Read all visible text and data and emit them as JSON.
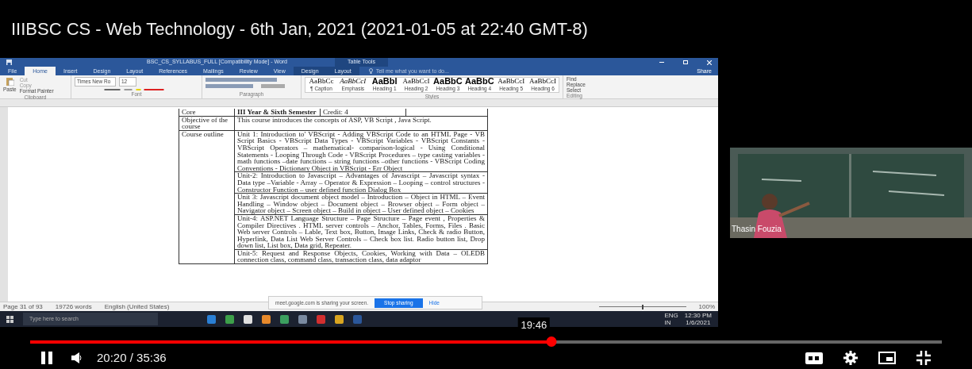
{
  "video_title": "IIIBSC CS - Web Technology - 6th Jan, 2021 (2021-01-05 at 22:40 GMT-8)",
  "word": {
    "title": "BSC_CS_SYLLABUS_FULL [Compatibility Mode] - Word",
    "context_group": "Table Tools",
    "tabs": [
      {
        "label": "File",
        "selected": false,
        "contextual": false
      },
      {
        "label": "Home",
        "selected": true,
        "contextual": false
      },
      {
        "label": "Insert",
        "selected": false,
        "contextual": false
      },
      {
        "label": "Design",
        "selected": false,
        "contextual": false
      },
      {
        "label": "Layout",
        "selected": false,
        "contextual": false
      },
      {
        "label": "References",
        "selected": false,
        "contextual": false
      },
      {
        "label": "Mailings",
        "selected": false,
        "contextual": false
      },
      {
        "label": "Review",
        "selected": false,
        "contextual": false
      },
      {
        "label": "View",
        "selected": false,
        "contextual": false
      },
      {
        "label": "Design",
        "selected": false,
        "contextual": true
      },
      {
        "label": "Layout",
        "selected": false,
        "contextual": true
      }
    ],
    "tell_me": "Tell me what you want to do...",
    "share": "Share",
    "clipboard": {
      "paste": "Paste",
      "cut": "Cut",
      "copy": "Copy",
      "format_painter": "Format Painter",
      "label": "Clipboard"
    },
    "font": {
      "name": "Times New Ro",
      "size": "12",
      "label": "Font"
    },
    "paragraph_label": "Paragraph",
    "styles": [
      {
        "sample": "AaBbCc",
        "name": "¶ Caption",
        "kind": "body"
      },
      {
        "sample": "AaBbCcI",
        "name": "Emphasis",
        "kind": "italic"
      },
      {
        "sample": "AaBbI",
        "name": "Heading 1",
        "kind": "heading"
      },
      {
        "sample": "AaBbCcI",
        "name": "Heading 2",
        "kind": "body"
      },
      {
        "sample": "AaBbC",
        "name": "Heading 3",
        "kind": "heading"
      },
      {
        "sample": "AaBbC",
        "name": "Heading 4",
        "kind": "heading"
      },
      {
        "sample": "AaBbCcI",
        "name": "Heading 5",
        "kind": "body"
      },
      {
        "sample": "AaBbCcI",
        "name": "Heading 6",
        "kind": "body"
      }
    ],
    "styles_label": "Styles",
    "editing": {
      "find": "Find",
      "replace": "Replace",
      "select": "Select",
      "label": "Editing"
    },
    "table": {
      "header": {
        "label": "Core",
        "semester": "III Year & Sixth Semester",
        "credit": "Credit: 4"
      },
      "rows": [
        {
          "label": "Objective of the course",
          "units": [
            "This course introduces the concepts of  ASP, VB Script , Java Script."
          ]
        },
        {
          "label": "Course outline",
          "units": [
            "Unit 1: Introduction to' VBScript - Adding VBScript Code to an HTML Page -  VB Script Basics - VBScript Data Types - VBScript Variables - VBScript Constants - VBScript Operators – mathematical- comparison-logical - Using Conditional Statements - Looping Through Code - VBScript Procedures – type casting variables - math functions –date functions – string functions –other functions - VBScript Coding Conventions - Dictionary Object in VBScript - Err Object",
            "Unit-2: Introduction to Javascript – Advantages of Javascript – Javascript syntax - Data type –Variable - Array – Operator & Expression – Looping – control structures - Constructor Function – user defined function Dialog Box",
            "Unit 3: Javascript document object model – Introduction – Object in HTML – Event Handling – Window object – Document object – Browser object – Form object – Navigator object – Screen object – Build in object – User defined object – Cookies",
            "Unit-4: ASP.NET Language Structure – Page Structure – Page event , Properties & Compiler Directives . HTML server controls – Anchor, Tables, Forms, Files . Basic Web server Controls – Lable, Text box, Button, Image Links, Check & radio Button, Hyperlink, Data List Web Server Controls – Check box list. Radio button list, Drop down list, List box, Data grid, Repeater.",
            "Unit-5: Request and Response Objects, Cookies, Working with Data – OLEDB connection class, command class, transaction class, data adaptor"
          ]
        }
      ]
    },
    "status_bar": {
      "page": "Page 31 of 93",
      "words": "19726 words",
      "language": "English (United States)",
      "zoom": "100%",
      "zoom_slider": {
        "level": 0.5
      }
    }
  },
  "sharing_bar": {
    "message": "meet.google.com is sharing your screen.",
    "stop": "Stop sharing",
    "hide": "Hide"
  },
  "taskbar": {
    "search_placeholder": "Type here to search",
    "language": "ENG",
    "region": "IN",
    "time": "12:30 PM",
    "date": "1/6/2021"
  },
  "camera": {
    "name": "Thasin Fouzia"
  },
  "player": {
    "playing": true,
    "level": 0.572,
    "hover_time": "19:46",
    "time": "20:20 / 35:36"
  }
}
